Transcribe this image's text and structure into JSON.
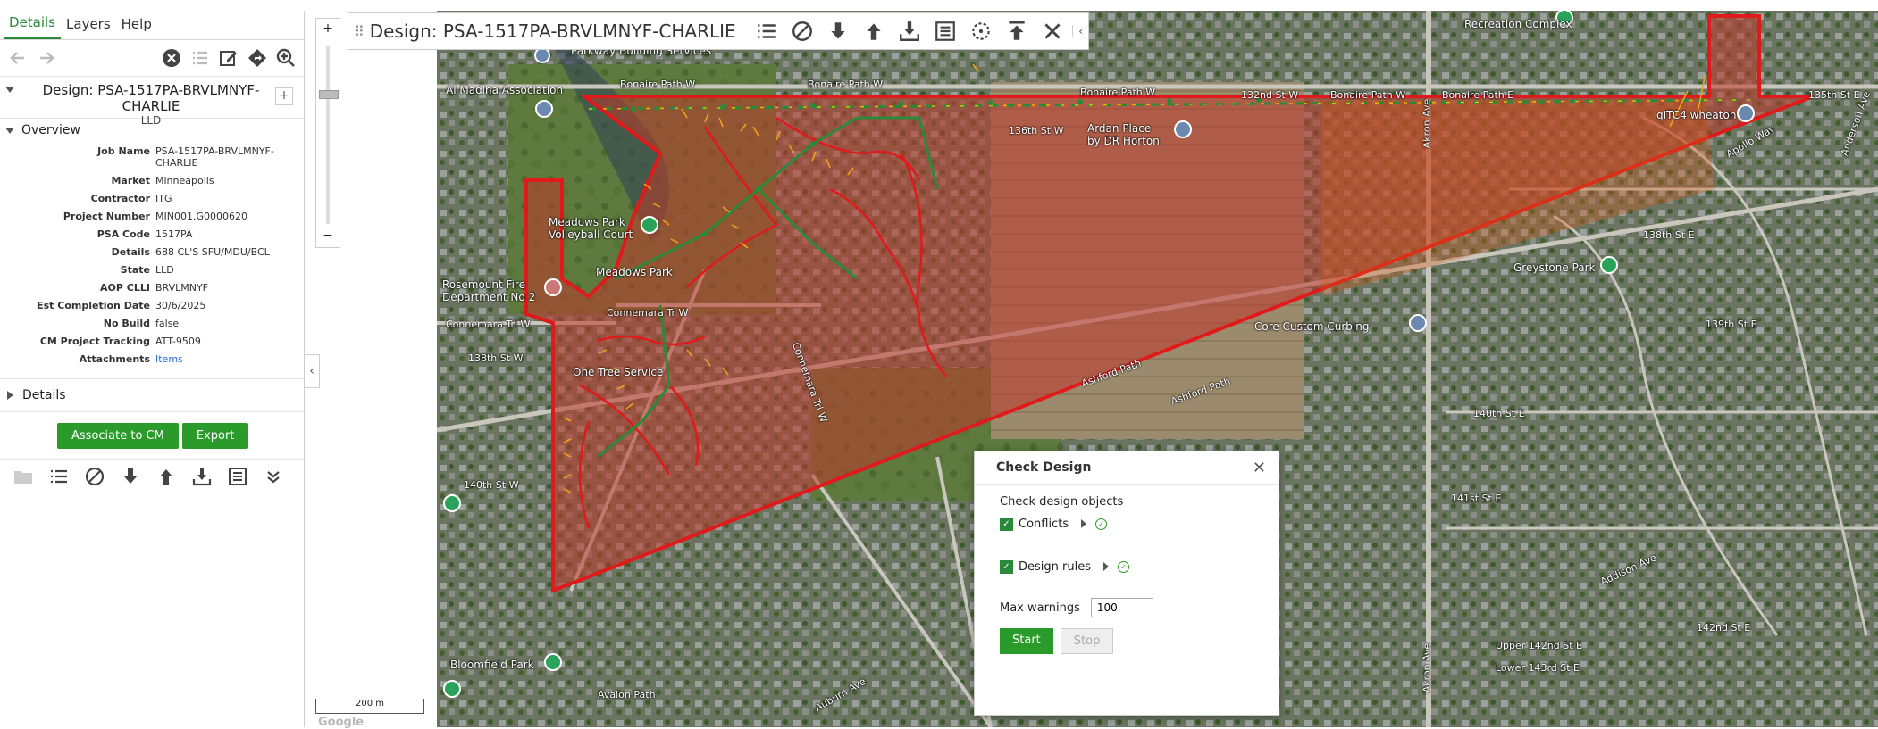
{
  "tabs": [
    "Details",
    "Layers",
    "Help"
  ],
  "design": {
    "title": "Design: PSA-1517PA-BRVLMNYF-CHARLIE",
    "subtitle": "LLD"
  },
  "overview": {
    "heading": "Overview",
    "rows": [
      {
        "label": "Job Name",
        "value": "PSA-1517PA-BRVLMNYF-CHARLIE"
      },
      {
        "label": "Market",
        "value": "Minneapolis"
      },
      {
        "label": "Contractor",
        "value": "ITG"
      },
      {
        "label": "Project Number",
        "value": "MIN001.G0000620"
      },
      {
        "label": "PSA Code",
        "value": "1517PA"
      },
      {
        "label": "Details",
        "value": "688 CL'S SFU/MDU/BCL"
      },
      {
        "label": "State",
        "value": "LLD"
      },
      {
        "label": "AOP CLLI",
        "value": "BRVLMNYF"
      },
      {
        "label": "Est Completion Date",
        "value": "30/6/2025"
      },
      {
        "label": "No Build",
        "value": "false"
      },
      {
        "label": "CM Project Tracking",
        "value": "ATT-9509"
      },
      {
        "label": "Attachments",
        "value": "Items"
      }
    ]
  },
  "details_section": "Details",
  "buttons": {
    "associate": "Associate to CM",
    "export": "Export"
  },
  "zoom": {
    "plus": "+",
    "minus": "−"
  },
  "scale": "200 m",
  "google": "Google",
  "toolbar": {
    "title": "Design: PSA-1517PA-BRVLMNYF-CHARLIE"
  },
  "dialog": {
    "title": "Check Design",
    "subtitle": "Check design objects",
    "conflicts": "Conflicts",
    "design_rules": "Design rules",
    "max_label": "Max warnings",
    "max_value": "100",
    "start": "Start",
    "stop": "Stop"
  },
  "map_labels": {
    "parkway": "Parkway\nBuilding Services",
    "almadina": "Al Madina Association",
    "bonaire1": "Bonaire Path W",
    "bonaire2": "Bonaire Path W",
    "bonaire3": "Bonaire Path W",
    "bonaire4": "Bonaire Path W",
    "bonaire5": "Bonaire Path E",
    "st132": "132nd St W",
    "st136": "136th St W",
    "st135": "135th St E",
    "ardan": "Ardan Place\nby DR Horton",
    "recreation": "Recreation Complex",
    "qltc": "qITC4 wheaton",
    "meadows": "Meadows Park\nVolleyball Court",
    "meadowspark": "Meadows Park",
    "rosemount": "Rosemount Fire\nDepartment No 2",
    "connemara1": "Connemara Tr W",
    "connemara2": "Connemara Trl W",
    "connemara3": "Connemara Trl W",
    "st138": "138th St W",
    "st140": "140th St W",
    "onetree": "One Tree Service",
    "akron1": "Akron Ave",
    "akron2": "Akron Ave",
    "corecurbing": "Core Custom Curbing",
    "greystone": "Greystone Park",
    "ashford1": "Ashford Path",
    "ashford2": "Ashford Path",
    "bloomfield": "Bloomfield Park",
    "avalon": "Avalon Path",
    "auburn": "Auburn Ave",
    "st141": "141st St E",
    "st139": "139th St E",
    "st138e": "138th St E",
    "st142": "142nd St E",
    "addison": "Addison Ave",
    "lower143": "Lower 143rd St E",
    "upper142": "Upper 142nd St E",
    "st140e": "140th St E",
    "apollo": "Apollo Way",
    "anderson": "Anderson Ave"
  }
}
